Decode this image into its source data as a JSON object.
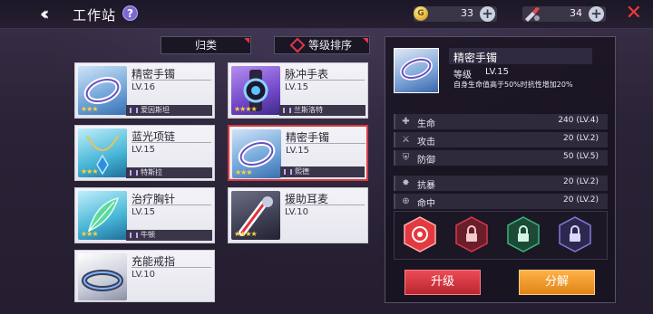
{
  "header": {
    "title": "工作站",
    "help": "?",
    "coin_count": "33",
    "tool_count": "34"
  },
  "filters": {
    "category_label": "归类",
    "sort_label": "等级排序"
  },
  "cards": [
    {
      "name": "精密手镯",
      "level": "LV.16",
      "owner": "爱因斯坦",
      "stars": "★★★"
    },
    {
      "name": "脉冲手表",
      "level": "LV.15",
      "owner": "兰斯洛特",
      "stars": "★★★★"
    },
    {
      "name": "蓝光项链",
      "level": "LV.15",
      "owner": "特斯拉",
      "stars": "★★★"
    },
    {
      "name": "精密手镯",
      "level": "LV.15",
      "owner": "熙德",
      "stars": "★★★"
    },
    {
      "name": "治疗胸针",
      "level": "LV.15",
      "owner": "牛顿",
      "stars": "★★★"
    },
    {
      "name": "援助耳麦",
      "level": "LV.10",
      "owner": "",
      "stars": "★★★★"
    },
    {
      "name": "充能戒指",
      "level": "LV.10",
      "owner": "",
      "stars": ""
    }
  ],
  "detail": {
    "name": "精密手镯",
    "level_key": "等级",
    "level_value": "LV.15",
    "description": "自身生命值高于50%时抗性增加20%",
    "stats": [
      {
        "label": "生命",
        "value": "240 (LV.4)",
        "icon": "heart-plus-icon"
      },
      {
        "label": "攻击",
        "value": "20 (LV.2)",
        "icon": "sword-icon"
      },
      {
        "label": "防御",
        "value": "50 (LV.5)",
        "icon": "shield-icon"
      },
      {
        "label": "抗暴",
        "value": "20 (LV.2)",
        "icon": "resist-icon"
      },
      {
        "label": "命中",
        "value": "20 (LV.2)",
        "icon": "crosshair-icon"
      }
    ],
    "upgrade_label": "升级",
    "dismantle_label": "分解"
  },
  "colors": {
    "accent_red": "#d83a3f",
    "accent_orange": "#f39a2b",
    "panel_dark": "#1b1725"
  }
}
